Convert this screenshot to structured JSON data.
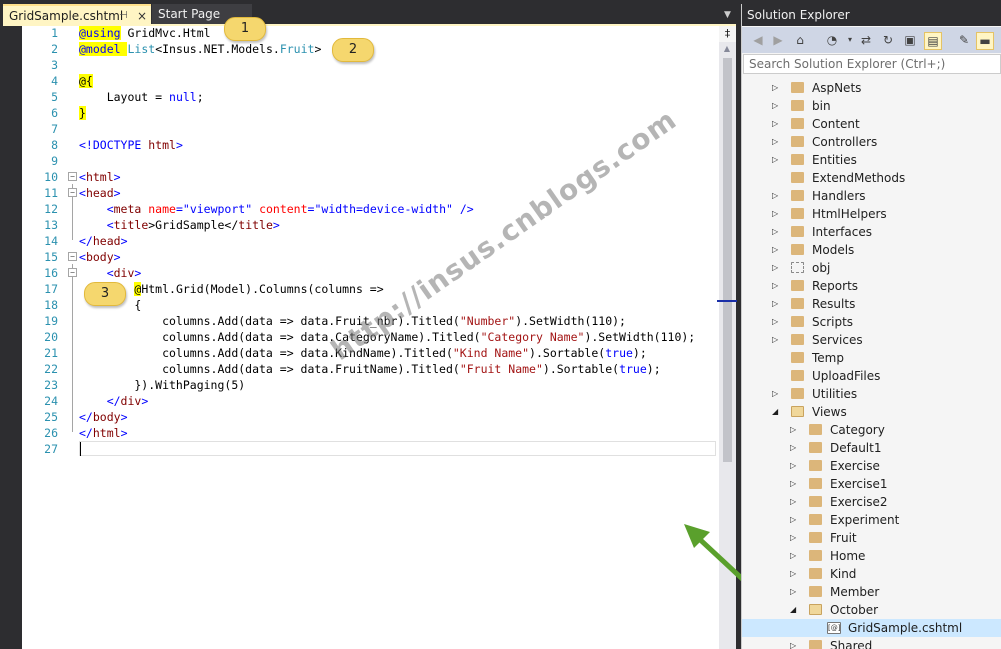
{
  "tabs": {
    "active_label": "GridSample.cshtml",
    "pin_glyph": "⊣",
    "close_glyph": "×",
    "start_label": "Start Page",
    "dropdown_glyph": "▼"
  },
  "editor": {
    "line_numbers": [
      "1",
      "2",
      "3",
      "4",
      "5",
      "6",
      "7",
      "8",
      "9",
      "10",
      "11",
      "12",
      "13",
      "14",
      "15",
      "16",
      "17",
      "18",
      "19",
      "20",
      "21",
      "22",
      "23",
      "24",
      "25",
      "26",
      "27"
    ],
    "lines": {
      "l1_kw": "@using",
      "l1_rest": " GridMvc.Html",
      "l2_kw": "@model",
      "l2_rest_a": " ",
      "l2_type": "List",
      "l2_rest_b": "<Insus.NET.Models.",
      "l2_type2": "Fruit",
      "l2_rest_c": ">",
      "l4": "@{",
      "l5_a": "    Layout = ",
      "l5_kw": "null",
      "l5_b": ";",
      "l6": "}",
      "l8_a": "<!DOCTYPE ",
      "l8_b": "html",
      "l8_c": ">",
      "l10_a": "<",
      "l10_b": "html",
      "l10_c": ">",
      "l11_a": "<",
      "l11_b": "head",
      "l11_c": ">",
      "l12_a": "    <",
      "l12_b": "meta",
      "l12_c": " name",
      "l12_d": "=",
      "l12_e": "\"viewport\"",
      "l12_f": " content",
      "l12_g": "=",
      "l12_h": "\"width=device-width\"",
      "l12_i": " />",
      "l13_a": "    <",
      "l13_b": "title",
      "l13_c": ">GridSample</",
      "l13_d": "title",
      "l13_e": ">",
      "l14_a": "</",
      "l14_b": "head",
      "l14_c": ">",
      "l15_a": "<",
      "l15_b": "body",
      "l15_c": ">",
      "l16_a": "    <",
      "l16_b": "div",
      "l16_c": ">",
      "l17_a": "        ",
      "l17_at": "@",
      "l17_b": "Html.Grid(Model).Columns(columns =>",
      "l18": "        {",
      "l19_a": "            columns.Add(data => data.Fruit_nbr).Titled(",
      "l19_s": "\"Number\"",
      "l19_b": ").SetWidth(110);",
      "l20_a": "            columns.Add(data => data.CategoryName).Titled(",
      "l20_s": "\"Category Name\"",
      "l20_b": ").SetWidth(110);",
      "l21_a": "            columns.Add(data => data.KindName).Titled(",
      "l21_s": "\"Kind Name\"",
      "l21_b": ").Sortable(",
      "l21_kw": "true",
      "l21_c": ");",
      "l22_a": "            columns.Add(data => data.FruitName).Titled(",
      "l22_s": "\"Fruit Name\"",
      "l22_b": ").Sortable(",
      "l22_kw": "true",
      "l22_c": ");",
      "l23": "        }).WithPaging(5)",
      "l24_a": "    </",
      "l24_b": "div",
      "l24_c": ">",
      "l25_a": "</",
      "l25_b": "body",
      "l25_c": ">",
      "l26_a": "</",
      "l26_b": "html",
      "l26_c": ">"
    },
    "fold_glyph": "−",
    "split_glyph": "‡",
    "scroll_up_glyph": "▲"
  },
  "callouts": {
    "c1": "1",
    "c2": "2",
    "c3": "3"
  },
  "watermark": "http://insus.cnblogs.com",
  "colors": {
    "arrow": "#5aa02c",
    "callout": "#f5d76e",
    "selection": "#cce8ff"
  },
  "solution_explorer": {
    "title": "Solution Explorer",
    "search_placeholder": "Search Solution Explorer (Ctrl+;)",
    "toolbar_icons": [
      "back-icon",
      "forward-icon",
      "home-icon",
      "history-icon",
      "sync-icon",
      "refresh-icon",
      "collapse-icon",
      "show-all-files-icon",
      "properties-icon",
      "preview-icon"
    ],
    "items": [
      {
        "label": "AspNets",
        "level": 0,
        "expander": "▷",
        "icon": "folder"
      },
      {
        "label": "bin",
        "level": 0,
        "expander": "▷",
        "icon": "folder"
      },
      {
        "label": "Content",
        "level": 0,
        "expander": "▷",
        "icon": "folder"
      },
      {
        "label": "Controllers",
        "level": 0,
        "expander": "▷",
        "icon": "folder"
      },
      {
        "label": "Entities",
        "level": 0,
        "expander": "▷",
        "icon": "folder"
      },
      {
        "label": "ExtendMethods",
        "level": 0,
        "expander": "",
        "icon": "folder"
      },
      {
        "label": "Handlers",
        "level": 0,
        "expander": "▷",
        "icon": "folder"
      },
      {
        "label": "HtmlHelpers",
        "level": 0,
        "expander": "▷",
        "icon": "folder"
      },
      {
        "label": "Interfaces",
        "level": 0,
        "expander": "▷",
        "icon": "folder"
      },
      {
        "label": "Models",
        "level": 0,
        "expander": "▷",
        "icon": "folder"
      },
      {
        "label": "obj",
        "level": 0,
        "expander": "▷",
        "icon": "dashed"
      },
      {
        "label": "Reports",
        "level": 0,
        "expander": "▷",
        "icon": "folder"
      },
      {
        "label": "Results",
        "level": 0,
        "expander": "▷",
        "icon": "folder"
      },
      {
        "label": "Scripts",
        "level": 0,
        "expander": "▷",
        "icon": "folder"
      },
      {
        "label": "Services",
        "level": 0,
        "expander": "▷",
        "icon": "folder"
      },
      {
        "label": "Temp",
        "level": 0,
        "expander": "",
        "icon": "folder"
      },
      {
        "label": "UploadFiles",
        "level": 0,
        "expander": "",
        "icon": "folder"
      },
      {
        "label": "Utilities",
        "level": 0,
        "expander": "▷",
        "icon": "folder"
      },
      {
        "label": "Views",
        "level": 0,
        "expander": "◢",
        "icon": "open"
      },
      {
        "label": "Category",
        "level": 1,
        "expander": "▷",
        "icon": "folder"
      },
      {
        "label": "Default1",
        "level": 1,
        "expander": "▷",
        "icon": "folder"
      },
      {
        "label": "Exercise",
        "level": 1,
        "expander": "▷",
        "icon": "folder"
      },
      {
        "label": "Exercise1",
        "level": 1,
        "expander": "▷",
        "icon": "folder"
      },
      {
        "label": "Exercise2",
        "level": 1,
        "expander": "▷",
        "icon": "folder"
      },
      {
        "label": "Experiment",
        "level": 1,
        "expander": "▷",
        "icon": "folder"
      },
      {
        "label": "Fruit",
        "level": 1,
        "expander": "▷",
        "icon": "folder"
      },
      {
        "label": "Home",
        "level": 1,
        "expander": "▷",
        "icon": "folder"
      },
      {
        "label": "Kind",
        "level": 1,
        "expander": "▷",
        "icon": "folder"
      },
      {
        "label": "Member",
        "level": 1,
        "expander": "▷",
        "icon": "folder"
      },
      {
        "label": "October",
        "level": 1,
        "expander": "◢",
        "icon": "open"
      },
      {
        "label": "GridSample.cshtml",
        "level": 2,
        "expander": "",
        "icon": "file",
        "file_glyph": "[@]"
      },
      {
        "label": "Shared",
        "level": 1,
        "expander": "▷",
        "icon": "folder"
      }
    ]
  }
}
